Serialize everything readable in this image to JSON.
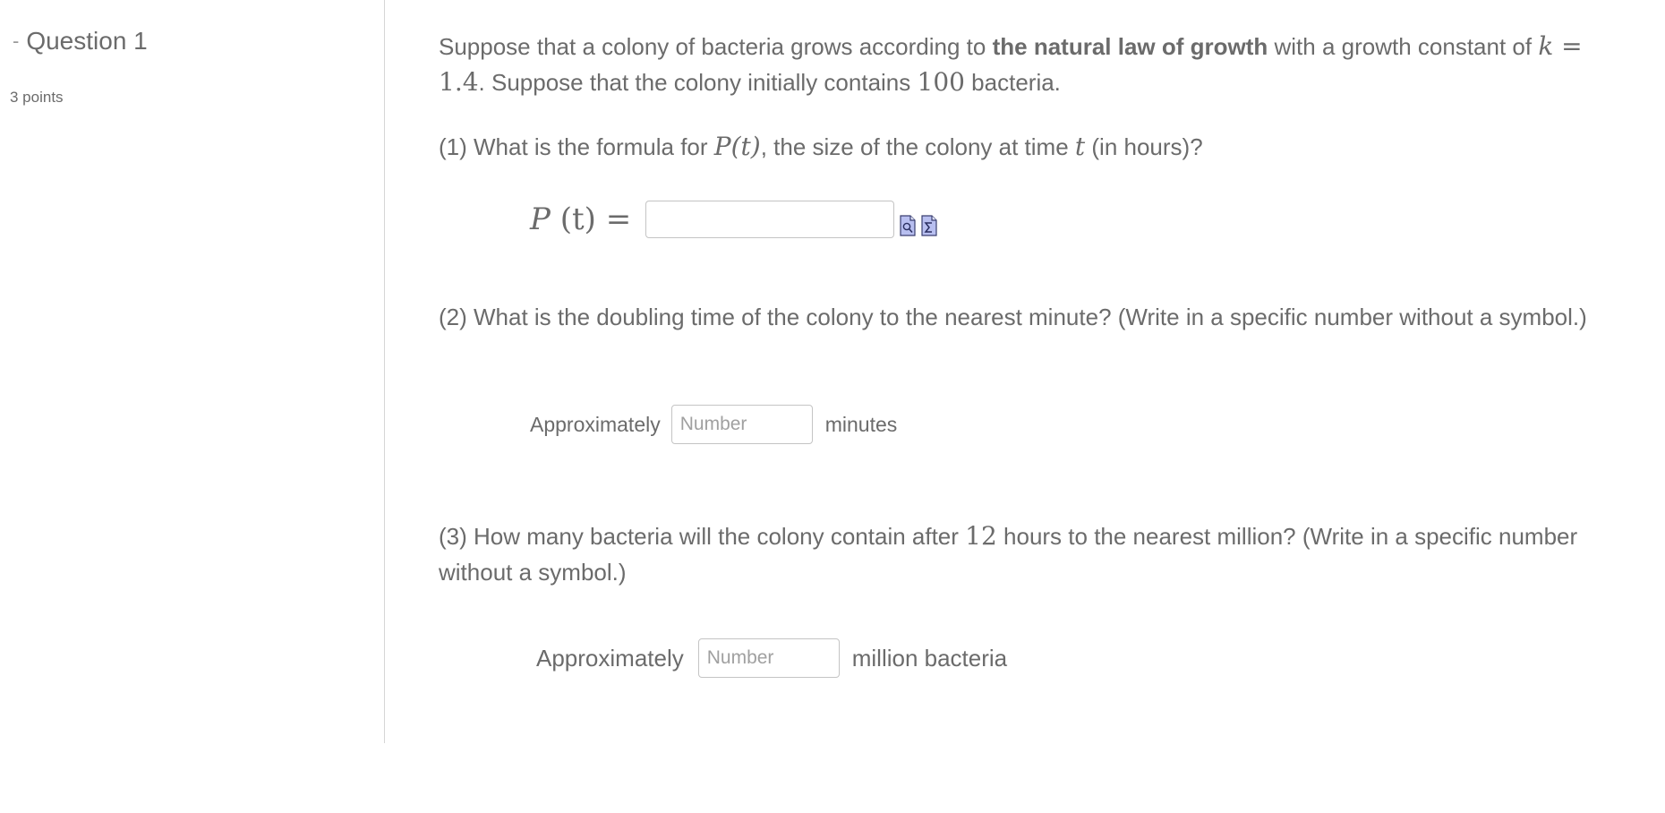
{
  "question_info": {
    "collapse_symbol": "-",
    "title": "Question 1",
    "points": "3 points"
  },
  "intro": {
    "text_a": "Suppose that a colony of bacteria grows according to ",
    "bold": "the natural law of growth",
    "text_b": " with a growth constant of ",
    "k_var": "k",
    "k_eq": " = 1.4",
    "text_c": ". Suppose that the colony initially contains ",
    "initial": "100",
    "text_d": " bacteria."
  },
  "part1": {
    "text_a": "(1) What is the formula for ",
    "func": "P(t)",
    "text_b": ", the size of the colony at time ",
    "tvar": "t",
    "text_c": " (in hours)?",
    "lhs_p": "P",
    "lhs_rest": " (t) =",
    "input_value": "",
    "preview_icon": "preview-icon",
    "equation_icon": "equation-editor-icon"
  },
  "part2": {
    "question": "(2) What is the doubling time of the colony to the nearest minute? (Write in a specific number without a symbol.)",
    "prefix": "Approximately",
    "placeholder": "Number",
    "suffix": "minutes"
  },
  "part3": {
    "text_a": "(3) How many bacteria will the colony contain after ",
    "hours": "12",
    "text_b": " hours to the nearest million? (Write in a specific number without a symbol.)",
    "prefix": "Approximately",
    "placeholder": "Number",
    "suffix": "million bacteria"
  },
  "colors": {
    "text": "#6b6b6b",
    "divider": "#d6d6d6",
    "input_border": "#c4c4c4",
    "icon_fill": "#b8bff0"
  }
}
